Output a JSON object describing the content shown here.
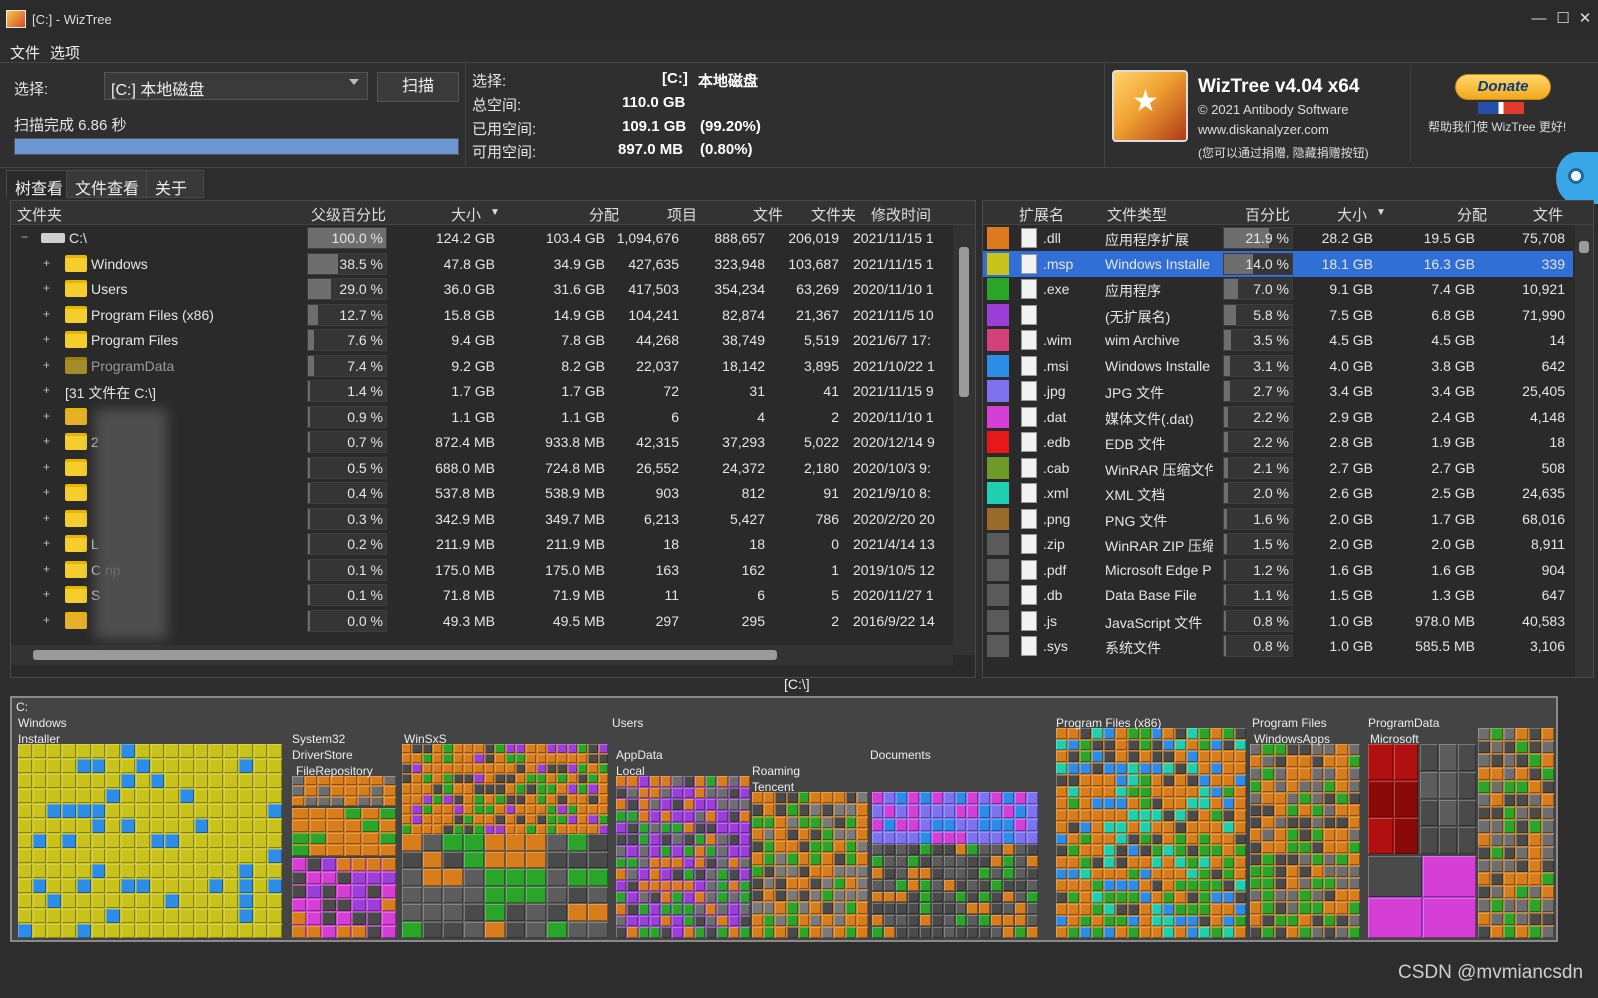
{
  "window": {
    "title": "[C:]  - WizTree",
    "controls": [
      "—",
      "☐",
      "✕"
    ]
  },
  "menu": [
    "文件",
    "选项"
  ],
  "scan": {
    "select_label": "选择:",
    "drive": "[C:] 本地磁盘",
    "scan_button": "扫描",
    "status": "扫描完成 6.86 秒",
    "progress": 1.0
  },
  "drive_info": {
    "select_label": "选择:",
    "select_value": "[C:]",
    "select_name": "本地磁盘",
    "total_label": "总空间:",
    "total_value": "110.0 GB",
    "used_label": "已用空间:",
    "used_value": "109.1 GB",
    "used_pct": "(99.20%)",
    "free_label": "可用空间:",
    "free_value": "897.0 MB",
    "free_pct": "(0.80%)"
  },
  "about": {
    "name": "WizTree v4.04 x64",
    "copyright": "© 2021 Antibody Software",
    "site": "www.diskanalyzer.com",
    "note": "(您可以通过捐赠, 隐藏捐赠按钮)"
  },
  "donate": {
    "button": "Donate",
    "text": "帮助我们使 WizTree 更好!"
  },
  "tabs": [
    "树查看",
    "文件查看",
    "关于"
  ],
  "tree": {
    "headers": [
      "文件夹",
      "父级百分比",
      "大小",
      "分配",
      "项目",
      "文件",
      "文件夹",
      "修改时间"
    ],
    "rows": [
      {
        "name": "C:\\",
        "pct": "100.0 %",
        "p": 1.0,
        "size": "124.2 GB",
        "alloc": "103.4 GB",
        "items": "1,094,676",
        "files": "888,657",
        "folders": "206,019",
        "mod": "2021/11/15 1",
        "level": 0,
        "icon": "drive"
      },
      {
        "name": "Windows",
        "pct": "38.5 %",
        "p": 0.385,
        "size": "47.8 GB",
        "alloc": "34.9 GB",
        "items": "427,635",
        "files": "323,948",
        "folders": "103,687",
        "mod": "2021/11/15 1",
        "level": 1,
        "icon": "folder"
      },
      {
        "name": "Users",
        "pct": "29.0 %",
        "p": 0.29,
        "size": "36.0 GB",
        "alloc": "31.6 GB",
        "items": "417,503",
        "files": "354,234",
        "folders": "63,269",
        "mod": "2020/11/10 1",
        "level": 1,
        "icon": "folder"
      },
      {
        "name": "Program Files (x86)",
        "pct": "12.7 %",
        "p": 0.127,
        "size": "15.8 GB",
        "alloc": "14.9 GB",
        "items": "104,241",
        "files": "82,874",
        "folders": "21,367",
        "mod": "2021/11/5 10",
        "level": 1,
        "icon": "folder"
      },
      {
        "name": "Program Files",
        "pct": "7.6 %",
        "p": 0.076,
        "size": "9.4 GB",
        "alloc": "7.8 GB",
        "items": "44,268",
        "files": "38,749",
        "folders": "5,519",
        "mod": "2021/6/7 17:",
        "level": 1,
        "icon": "folder"
      },
      {
        "name": "ProgramData",
        "pct": "7.4 %",
        "p": 0.074,
        "size": "9.2 GB",
        "alloc": "8.2 GB",
        "items": "22,037",
        "files": "18,142",
        "folders": "3,895",
        "mod": "2021/10/22 1",
        "level": 1,
        "icon": "folder-dim"
      },
      {
        "name": "[31 文件在 C:\\]",
        "pct": "1.4 %",
        "p": 0.014,
        "size": "1.7 GB",
        "alloc": "1.7 GB",
        "items": "72",
        "files": "31",
        "folders": "41",
        "mod": "2021/11/15 9",
        "level": 1,
        "icon": "none"
      },
      {
        "name": "",
        "pct": "0.9 %",
        "p": 0.009,
        "size": "1.1 GB",
        "alloc": "1.1 GB",
        "items": "6",
        "files": "4",
        "folders": "2",
        "mod": "2020/11/10 1",
        "level": 1,
        "icon": "gear"
      },
      {
        "name": "2",
        "pct": "0.7 %",
        "p": 0.007,
        "size": "872.4 MB",
        "alloc": "933.8 MB",
        "items": "42,315",
        "files": "37,293",
        "folders": "5,022",
        "mod": "2020/12/14 9",
        "level": 1,
        "icon": "folder"
      },
      {
        "name": "",
        "pct": "0.5 %",
        "p": 0.005,
        "size": "688.0 MB",
        "alloc": "724.8 MB",
        "items": "26,552",
        "files": "24,372",
        "folders": "2,180",
        "mod": "2020/10/3 9:",
        "level": 1,
        "icon": "folder"
      },
      {
        "name": "",
        "pct": "0.4 %",
        "p": 0.004,
        "size": "537.8 MB",
        "alloc": "538.9 MB",
        "items": "903",
        "files": "812",
        "folders": "91",
        "mod": "2021/9/10 8:",
        "level": 1,
        "icon": "folder"
      },
      {
        "name": "",
        "pct": "0.3 %",
        "p": 0.003,
        "size": "342.9 MB",
        "alloc": "349.7 MB",
        "items": "6,213",
        "files": "5,427",
        "folders": "786",
        "mod": "2020/2/20 20",
        "level": 1,
        "icon": "folder"
      },
      {
        "name": "L",
        "pct": "0.2 %",
        "p": 0.002,
        "size": "211.9 MB",
        "alloc": "211.9 MB",
        "items": "18",
        "files": "18",
        "folders": "0",
        "mod": "2021/4/14 13",
        "level": 1,
        "icon": "folder"
      },
      {
        "name": "C          np",
        "pct": "0.1 %",
        "p": 0.001,
        "size": "175.0 MB",
        "alloc": "175.0 MB",
        "items": "163",
        "files": "162",
        "folders": "1",
        "mod": "2019/10/5 12",
        "level": 1,
        "icon": "folder"
      },
      {
        "name": "S",
        "pct": "0.1 %",
        "p": 0.001,
        "size": "71.8 MB",
        "alloc": "71.9 MB",
        "items": "11",
        "files": "6",
        "folders": "5",
        "mod": "2020/11/27 1",
        "level": 1,
        "icon": "folder"
      },
      {
        "name": "",
        "pct": "0.0 %",
        "p": 0.0,
        "size": "49.3 MB",
        "alloc": "49.5 MB",
        "items": "297",
        "files": "295",
        "folders": "2",
        "mod": "2016/9/22 14",
        "level": 1,
        "icon": "gear"
      }
    ]
  },
  "ext": {
    "headers": [
      "扩展名",
      "文件类型",
      "百分比",
      "大小",
      "分配",
      "文件"
    ],
    "rows": [
      {
        "color": "#e07a1e",
        "ext": ".dll",
        "type": "应用程序扩展",
        "pct": "21.9 %",
        "p": 0.219,
        "size": "28.2 GB",
        "alloc": "19.5 GB",
        "files": "75,708"
      },
      {
        "color": "#c9c21a",
        "ext": ".msp",
        "type": "Windows Installe",
        "pct": "14.0 %",
        "p": 0.14,
        "size": "18.1 GB",
        "alloc": "16.3 GB",
        "files": "339",
        "selected": true
      },
      {
        "color": "#2aa52a",
        "ext": ".exe",
        "type": "应用程序",
        "pct": "7.0 %",
        "p": 0.07,
        "size": "9.1 GB",
        "alloc": "7.4 GB",
        "files": "10,921"
      },
      {
        "color": "#9b3fd8",
        "ext": "",
        "type": "(无扩展名)",
        "pct": "5.8 %",
        "p": 0.058,
        "size": "7.5 GB",
        "alloc": "6.8 GB",
        "files": "71,990"
      },
      {
        "color": "#d2417a",
        "ext": ".wim",
        "type": "wim Archive",
        "pct": "3.5 %",
        "p": 0.035,
        "size": "4.5 GB",
        "alloc": "4.5 GB",
        "files": "14"
      },
      {
        "color": "#2d8ce8",
        "ext": ".msi",
        "type": "Windows Installe",
        "pct": "3.1 %",
        "p": 0.031,
        "size": "4.0 GB",
        "alloc": "3.8 GB",
        "files": "642"
      },
      {
        "color": "#7f72f0",
        "ext": ".jpg",
        "type": "JPG 文件",
        "pct": "2.7 %",
        "p": 0.027,
        "size": "3.4 GB",
        "alloc": "3.4 GB",
        "files": "25,405"
      },
      {
        "color": "#d63fd6",
        "ext": ".dat",
        "type": "媒体文件(.dat)",
        "pct": "2.2 %",
        "p": 0.022,
        "size": "2.9 GB",
        "alloc": "2.4 GB",
        "files": "4,148"
      },
      {
        "color": "#e81818",
        "ext": ".edb",
        "type": "EDB 文件",
        "pct": "2.2 %",
        "p": 0.022,
        "size": "2.8 GB",
        "alloc": "1.9 GB",
        "files": "18"
      },
      {
        "color": "#6e9a2a",
        "ext": ".cab",
        "type": "WinRAR 压缩文件",
        "pct": "2.1 %",
        "p": 0.021,
        "size": "2.7 GB",
        "alloc": "2.7 GB",
        "files": "508"
      },
      {
        "color": "#1fd0b0",
        "ext": ".xml",
        "type": "XML 文档",
        "pct": "2.0 %",
        "p": 0.02,
        "size": "2.6 GB",
        "alloc": "2.5 GB",
        "files": "24,635"
      },
      {
        "color": "#9a6a2a",
        "ext": ".png",
        "type": "PNG 文件",
        "pct": "1.6 %",
        "p": 0.016,
        "size": "2.0 GB",
        "alloc": "1.7 GB",
        "files": "68,016"
      },
      {
        "color": "#5a5a5a",
        "ext": ".zip",
        "type": "WinRAR ZIP 压缩",
        "pct": "1.5 %",
        "p": 0.015,
        "size": "2.0 GB",
        "alloc": "2.0 GB",
        "files": "8,911"
      },
      {
        "color": "#5a5a5a",
        "ext": ".pdf",
        "type": "Microsoft Edge P",
        "pct": "1.2 %",
        "p": 0.012,
        "size": "1.6 GB",
        "alloc": "1.6 GB",
        "files": "904"
      },
      {
        "color": "#5a5a5a",
        "ext": ".db",
        "type": "Data Base File",
        "pct": "1.1 %",
        "p": 0.011,
        "size": "1.5 GB",
        "alloc": "1.3 GB",
        "files": "647"
      },
      {
        "color": "#5a5a5a",
        "ext": ".js",
        "type": "JavaScript 文件",
        "pct": "0.8 %",
        "p": 0.008,
        "size": "1.0 GB",
        "alloc": "978.0 MB",
        "files": "40,583"
      },
      {
        "color": "#5a5a5a",
        "ext": ".sys",
        "type": "系统文件",
        "pct": "0.8 %",
        "p": 0.008,
        "size": "1.0 GB",
        "alloc": "585.5 MB",
        "files": "3,106"
      }
    ]
  },
  "treemap": {
    "path": "[C:\\]",
    "root": "C:",
    "labels": [
      "Windows",
      "Installer",
      "System32",
      "DriverStore",
      "FileRepository",
      "WinSxS",
      "Users",
      "AppData",
      "Local",
      "Roaming",
      "Tencent",
      "Documents",
      "Program Files (x86)",
      "Program Files",
      "WindowsApps",
      "ProgramData",
      "Microsoft"
    ]
  },
  "watermark": "CSDN @mvmiancsdn"
}
